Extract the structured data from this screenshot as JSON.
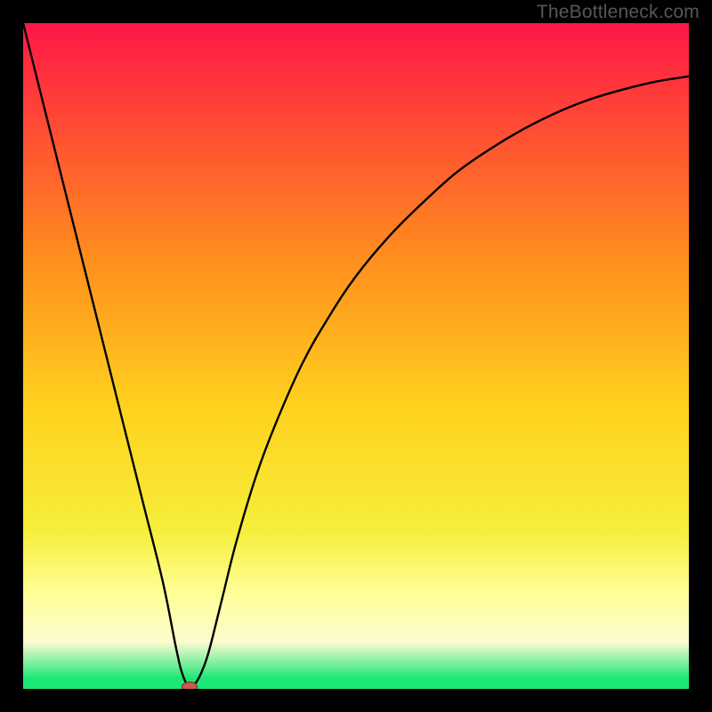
{
  "watermark": "TheBottleneck.com",
  "colors": {
    "top": "#ff1646",
    "mid_upper": "#ff8a1f",
    "mid": "#ffd21e",
    "mid_lower": "#f6ee3a",
    "pale_band": "#ffff9a",
    "cream": "#fcfbd0",
    "green": "#1be775",
    "curve": "#000000",
    "marker_fill": "#c45a50",
    "marker_stroke": "#7a2f28"
  },
  "chart_data": {
    "type": "line",
    "title": "",
    "xlabel": "",
    "ylabel": "",
    "xlim": [
      0,
      100
    ],
    "ylim": [
      0,
      100
    ],
    "x": [
      0,
      3,
      6,
      9,
      12,
      15,
      18,
      21,
      23,
      24,
      25,
      26,
      27,
      28,
      30,
      32,
      35,
      38,
      42,
      46,
      50,
      55,
      60,
      65,
      70,
      75,
      80,
      85,
      90,
      95,
      100
    ],
    "values": [
      100,
      88,
      76,
      64,
      52,
      40,
      28,
      16,
      6,
      2,
      0.3,
      1,
      3,
      6,
      14,
      22,
      32,
      40,
      49,
      56,
      62,
      68,
      73,
      77.5,
      81,
      84,
      86.5,
      88.5,
      90,
      91.2,
      92
    ],
    "series": [
      {
        "name": "bottleneck-curve",
        "x": [
          0,
          3,
          6,
          9,
          12,
          15,
          18,
          21,
          23,
          24,
          25,
          26,
          27,
          28,
          30,
          32,
          35,
          38,
          42,
          46,
          50,
          55,
          60,
          65,
          70,
          75,
          80,
          85,
          90,
          95,
          100
        ],
        "y": [
          100,
          88,
          76,
          64,
          52,
          40,
          28,
          16,
          6,
          2,
          0.3,
          1,
          3,
          6,
          14,
          22,
          32,
          40,
          49,
          56,
          62,
          68,
          73,
          77.5,
          81,
          84,
          86.5,
          88.5,
          90,
          91.2,
          92
        ]
      }
    ],
    "marker": {
      "x": 25,
      "y": 0.3
    }
  }
}
